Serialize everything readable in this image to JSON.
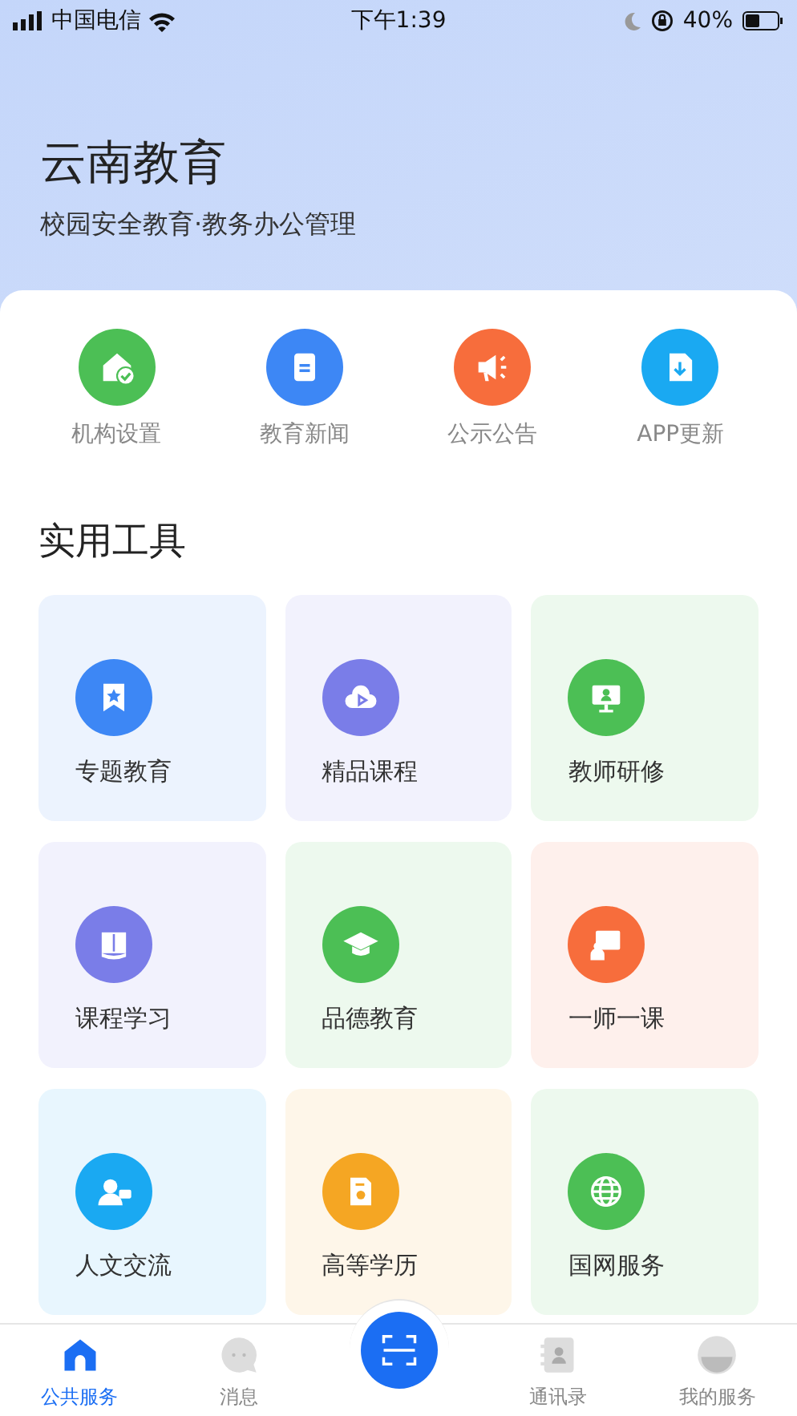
{
  "status_bar": {
    "carrier": "中国电信",
    "time": "下午1:39",
    "battery": "40%"
  },
  "header": {
    "title": "云南教育",
    "subtitle": "校园安全教育·教务办公管理"
  },
  "quick_links": [
    {
      "label": "机构设置",
      "kind": "house",
      "color": "#4cbf55"
    },
    {
      "label": "教育新闻",
      "kind": "clipboard",
      "color": "#3d87f5"
    },
    {
      "label": "公示公告",
      "kind": "megaphone",
      "color": "#f76d3c"
    },
    {
      "label": "APP更新",
      "kind": "download",
      "color": "#1aa9f2"
    }
  ],
  "tools": {
    "title": "实用工具",
    "items": [
      {
        "label": "专题教育",
        "kind": "bookmark",
        "color": "#3d87f5"
      },
      {
        "label": "精品课程",
        "kind": "cloud",
        "color": "#7a7de8"
      },
      {
        "label": "教师研修",
        "kind": "monitor",
        "color": "#4cbf55"
      },
      {
        "label": "课程学习",
        "kind": "book",
        "color": "#7a7de8"
      },
      {
        "label": "品德教育",
        "kind": "cap",
        "color": "#4cbf55"
      },
      {
        "label": "一师一课",
        "kind": "board",
        "color": "#f76d3c"
      },
      {
        "label": "人文交流",
        "kind": "person",
        "color": "#1aa9f2"
      },
      {
        "label": "高等学历",
        "kind": "certificate",
        "color": "#f5a623"
      },
      {
        "label": "国网服务",
        "kind": "globe",
        "color": "#4cbf55"
      }
    ]
  },
  "tab_bar": [
    {
      "label": "公共服务",
      "kind": "home",
      "selected": true
    },
    {
      "label": "消息",
      "kind": "chat",
      "selected": false
    },
    {
      "kind": "scan",
      "selected": false
    },
    {
      "label": "通讯录",
      "kind": "contacts",
      "selected": false
    },
    {
      "label": "我的服务",
      "kind": "profile",
      "selected": false
    }
  ]
}
